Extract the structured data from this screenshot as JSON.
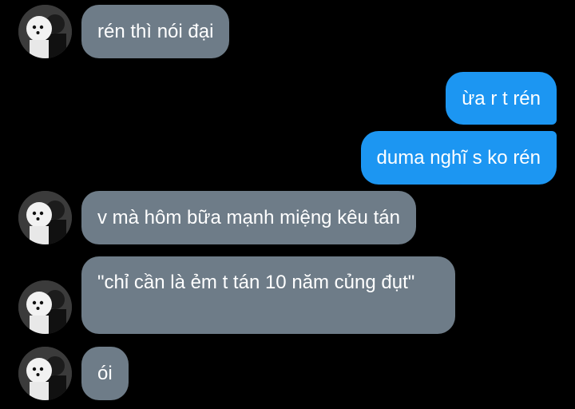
{
  "conversation": {
    "messages": [
      {
        "side": "in",
        "text": "rén thì nói đại"
      },
      {
        "side": "out",
        "text": "ừa r t rén"
      },
      {
        "side": "out",
        "text": "duma nghĩ s ko rén"
      },
      {
        "side": "in",
        "text": "v mà hôm bữa mạnh miệng kêu tán"
      },
      {
        "side": "in",
        "text": "\"chỉ cần là ẻm t tán 10 năm củng đụt\""
      },
      {
        "side": "in",
        "text": "ói"
      }
    ]
  },
  "colors": {
    "background": "#000000",
    "incoming_bubble": "#6e7c88",
    "outgoing_bubble": "#1c96f2",
    "text": "#ffffff"
  },
  "icons": {
    "avatar": "contact-avatar-icon"
  }
}
